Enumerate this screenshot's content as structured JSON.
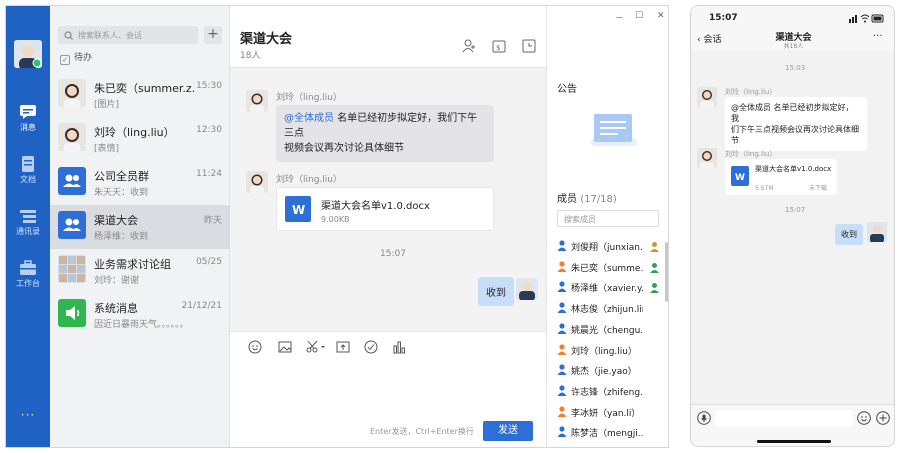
{
  "sidebar": {
    "items": [
      {
        "label": "消息",
        "icon": "message-icon"
      },
      {
        "label": "文档",
        "icon": "document-icon"
      },
      {
        "label": "通讯录",
        "icon": "contacts-icon"
      },
      {
        "label": "工作台",
        "icon": "workbench-icon"
      }
    ],
    "more": "···"
  },
  "conversations": {
    "search_placeholder": "搜索联系人、会话",
    "add": "+",
    "todo": "待办",
    "items": [
      {
        "name": "朱已奕（summer.z...",
        "time": "15:30",
        "sub": "[图片]"
      },
      {
        "name": "刘玲（ling.liu）",
        "time": "12:30",
        "sub": "[表情]"
      },
      {
        "name": "公司全员群",
        "time": "11:24",
        "sub": "朱天天：收到"
      },
      {
        "name": "渠道大会",
        "time": "昨天",
        "sub": "杨泽维：收到"
      },
      {
        "name": "业务需求讨论组",
        "time": "05/25",
        "sub": "刘玲：谢谢"
      },
      {
        "name": "系统消息",
        "time": "21/12/21",
        "sub": "因近日暴雨天气。。。。。。"
      }
    ]
  },
  "chat": {
    "title": "渠道大会",
    "count": "18人",
    "messages": {
      "m1_sender": "刘玲（ling.liu）",
      "m1_at": "@全体成员",
      "m1_text1": " 名单已经初步拟定好，我们下午三点",
      "m1_text2": "视频会议再次讨论具体细节",
      "m2_sender": "刘玲（ling.liu）",
      "file_name": "渠道大会名单v1.0.docx",
      "file_size": "9.00KB",
      "time": "15:07",
      "reply": "收到"
    },
    "hint": "Enter发送，Ctrl+Enter换行",
    "send": "发送"
  },
  "window": {
    "minimize": "－",
    "maximize": "☐",
    "close": "✕"
  },
  "panel": {
    "announcement": "公告",
    "members_label": "成员",
    "members_count": "(17/18)",
    "search_placeholder": "搜索成员",
    "members": [
      "刘俊翔（junxian...",
      "朱已奕（summe...",
      "杨泽维（xavier.y...",
      "林志俊（zhijun.lin）",
      "姚晨光（chengu...",
      "刘玲（ling.liu）",
      "姚杰（jie.yao）",
      "许志锋（zhifeng...",
      "李冰妍（yan.li）",
      "陈梦洁（mengji..."
    ]
  },
  "phone": {
    "status_time": "15:07",
    "back": "会话",
    "title": "渠道大会",
    "subtitle": "共18人",
    "more": "···",
    "t1": "15:03",
    "sender": "刘玲（ling.liu）",
    "m1_l1": "@全体成员 名单已经初步拟定好，我",
    "m1_l2": "们下午三点视频会议再次讨论具体细",
    "m1_l3": "节",
    "sender2": "刘玲（ling.liu）",
    "file_name": "渠道大会名单v1.0.docx",
    "file_size": "5.57M",
    "file_status": "未下载",
    "t2": "15:07",
    "reply": "收到"
  },
  "colors": {
    "brand": "#1f62c4",
    "accent": "#2d6fd6"
  }
}
